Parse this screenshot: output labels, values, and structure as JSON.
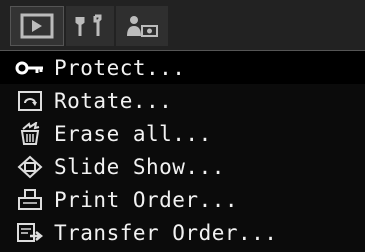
{
  "tabs": [
    {
      "icon": "playback-icon",
      "active": true
    },
    {
      "icon": "setup-tools-icon",
      "active": false
    },
    {
      "icon": "my-camera-icon",
      "active": false
    }
  ],
  "menu": {
    "selected_index": 0,
    "items": [
      {
        "label": "Protect...",
        "icon": "key-icon"
      },
      {
        "label": "Rotate...",
        "icon": "rotate-icon"
      },
      {
        "label": "Erase all...",
        "icon": "erase-all-icon"
      },
      {
        "label": "Slide Show...",
        "icon": "slideshow-icon"
      },
      {
        "label": "Print Order...",
        "icon": "print-order-icon"
      },
      {
        "label": "Transfer Order...",
        "icon": "transfer-order-icon"
      }
    ]
  },
  "colors": {
    "background": "#0b0b0b",
    "tab_bar": "#222222",
    "text": "#f2f2f2"
  }
}
